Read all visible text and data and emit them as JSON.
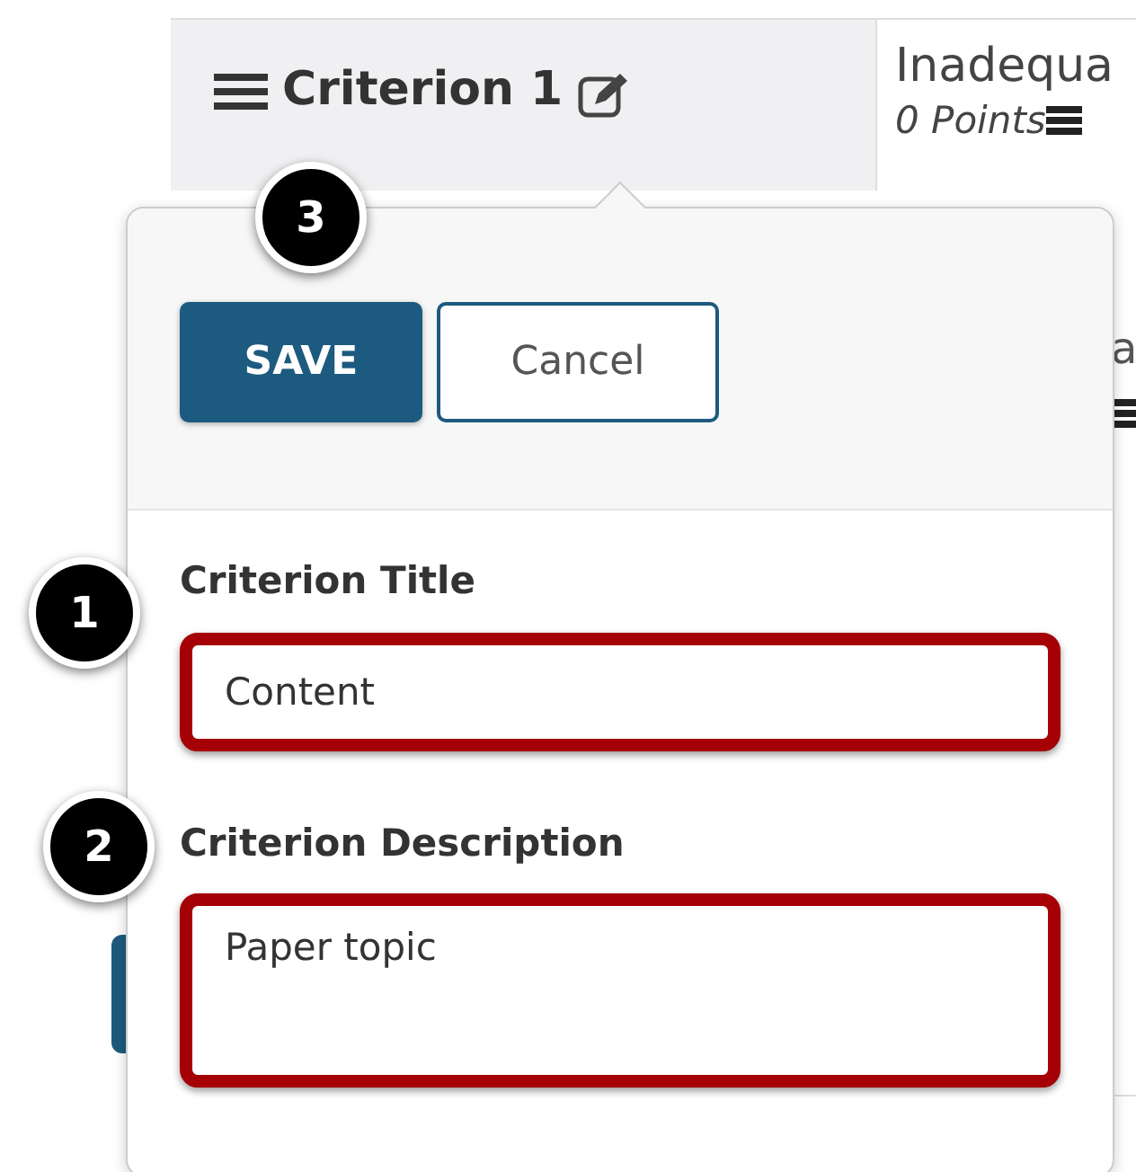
{
  "rubric": {
    "criterion_title": "Criterion 1",
    "level_title": "Inadequa",
    "level_points": "0 Points",
    "row_2_fragment": "a"
  },
  "popover": {
    "buttons": [
      {
        "label": "SAVE",
        "kind": "primary"
      },
      {
        "label": "Cancel",
        "kind": "secondary"
      }
    ],
    "fields": [
      {
        "label": "Criterion Title",
        "value": "Content",
        "kind": "input",
        "highlighted": true
      },
      {
        "label": "Criterion Description",
        "value": "Paper topic",
        "kind": "textarea",
        "highlighted": true
      }
    ]
  },
  "callouts": [
    {
      "number": "1"
    },
    {
      "number": "2"
    },
    {
      "number": "3"
    }
  ]
}
